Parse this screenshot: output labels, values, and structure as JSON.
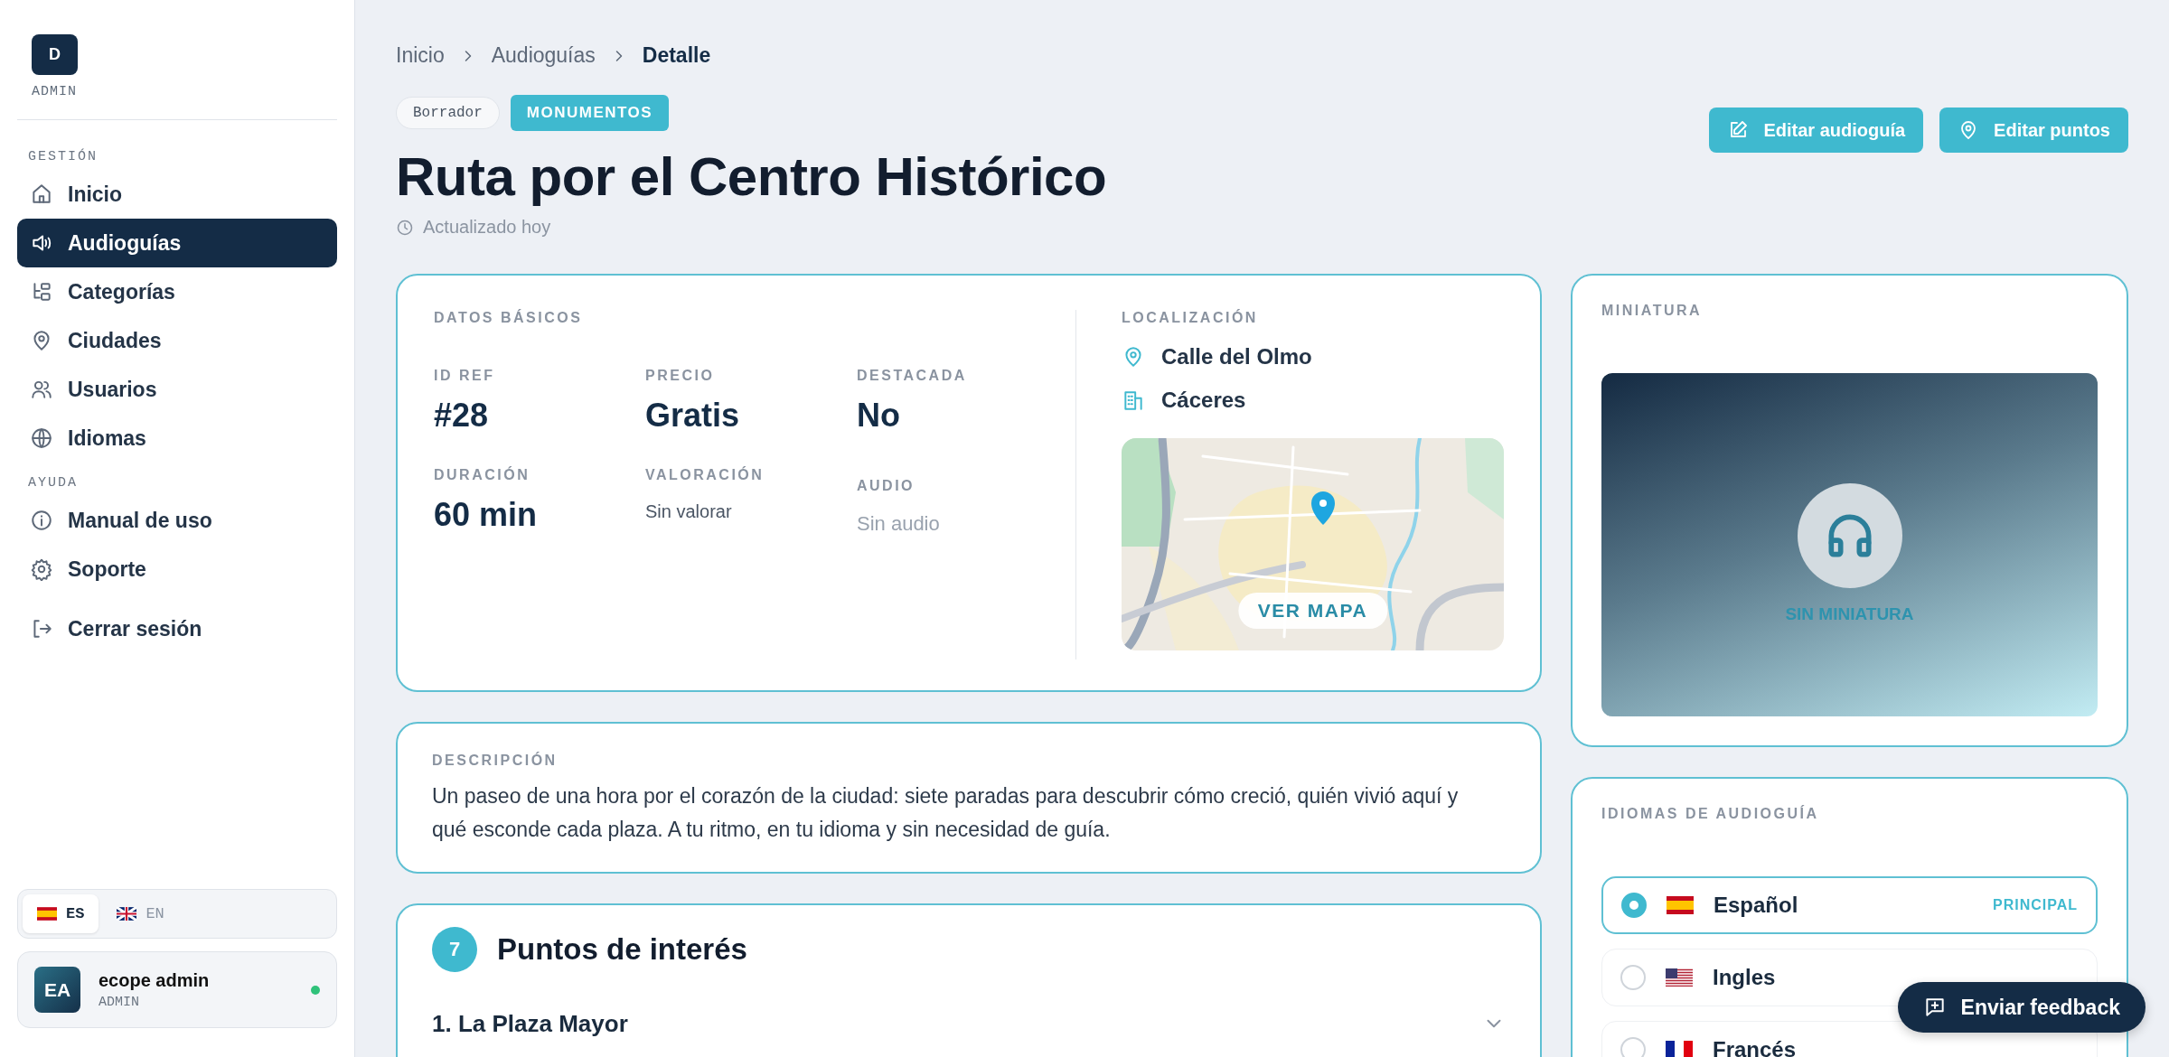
{
  "sidebar": {
    "logo": "D",
    "role": "ADMIN",
    "sections": [
      {
        "heading": "GESTIÓN",
        "items": [
          {
            "label": "Inicio",
            "selected": false
          },
          {
            "label": "Audioguías",
            "selected": true
          },
          {
            "label": "Categorías",
            "selected": false
          },
          {
            "label": "Ciudades",
            "selected": false
          },
          {
            "label": "Usuarios",
            "selected": false
          },
          {
            "label": "Idiomas",
            "selected": false
          }
        ]
      },
      {
        "heading": "AYUDA",
        "items": [
          {
            "label": "Manual de uso",
            "selected": false
          },
          {
            "label": "Soporte",
            "selected": false
          }
        ]
      }
    ],
    "logout": "Cerrar sesión",
    "languages": [
      {
        "label": "ES",
        "selected": true
      },
      {
        "label": "EN",
        "selected": false
      }
    ],
    "user": {
      "initials": "EA",
      "name": "ecope admin",
      "role": "ADMIN",
      "online": true
    }
  },
  "breadcrumb": [
    {
      "label": "Inicio",
      "current": false
    },
    {
      "label": "Audioguías",
      "current": false
    },
    {
      "label": "Detalle",
      "current": true
    }
  ],
  "badges": [
    {
      "label": "Borrador",
      "kind": "status"
    },
    {
      "label": "MONUMENTOS",
      "kind": "category"
    }
  ],
  "title": "Ruta por el Centro Histórico",
  "updated": "Actualizado hoy",
  "actions": [
    "Editar audioguía",
    "Editar puntos"
  ],
  "basic_data": {
    "heading": "DATOS BÁSICOS",
    "fields": [
      {
        "label": "ID REF",
        "value": "#28",
        "kind": "big"
      },
      {
        "label": "PRECIO",
        "value": "Gratis",
        "kind": "big"
      },
      {
        "label": "DESTACADA",
        "value": "No",
        "kind": "big"
      },
      {
        "label": "DURACIÓN",
        "value": "60 min",
        "kind": "big"
      },
      {
        "label": "VALORACIÓN",
        "value": "Sin valorar",
        "kind": "small"
      },
      {
        "label": "AUDIO",
        "value": "Sin audio",
        "kind": "faint"
      }
    ]
  },
  "location": {
    "heading": "LOCALIZACIÓN",
    "address": "Calle del Olmo",
    "city": "Cáceres",
    "map": {
      "kind": "picture",
      "button": "VER MAPA"
    }
  },
  "thumbnail": {
    "heading": "MINIATURA",
    "empty_label": "SIN MINIATURA"
  },
  "description": {
    "heading": "DESCRIPCIÓN",
    "text": "Un paseo de una hora por el corazón de la ciudad: siete paradas para descubrir cómo creció, quién vivió aquí y qué esconde cada plaza. A tu ritmo, en tu idioma y sin necesidad de guía."
  },
  "points": {
    "count": "7",
    "heading": "Puntos de interés",
    "items": [
      {
        "label": "1. La Plaza Mayor",
        "expanded": false
      }
    ]
  },
  "guide_languages": {
    "heading": "IDIOMAS DE AUDIOGUÍA",
    "items": [
      {
        "label": "Español",
        "selected": true,
        "badge": "PRINCIPAL"
      },
      {
        "label": "Ingles",
        "selected": false
      },
      {
        "label": "Francés",
        "selected": false
      }
    ]
  },
  "feedback_button": "Enviar feedback"
}
